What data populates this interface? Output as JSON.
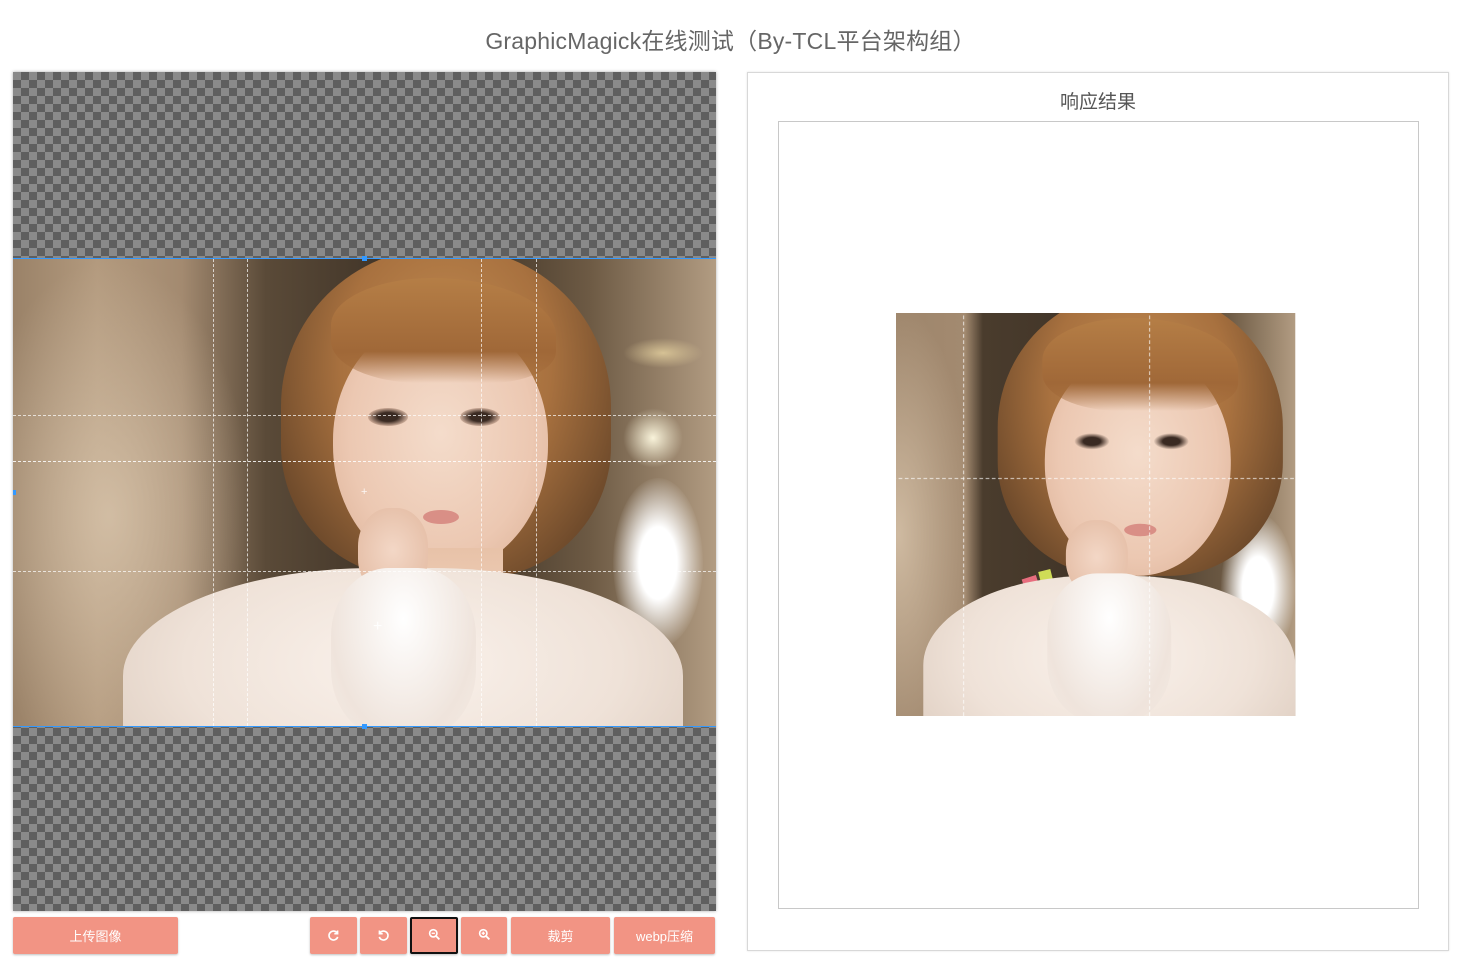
{
  "page": {
    "title": "GraphicMagick在线测试（By-TCL平台架构组）"
  },
  "editor": {
    "image_alt": "待裁剪图片（女孩肖像）"
  },
  "toolbar": {
    "upload_label": "上传图像",
    "rotate_right_icon": "rotate-right-icon",
    "rotate_left_icon": "rotate-left-icon",
    "zoom_out_icon": "zoom-out-icon",
    "zoom_in_icon": "zoom-in-icon",
    "crop_label": "裁剪",
    "webp_label": "webp压缩",
    "active_button": "zoom-out"
  },
  "result": {
    "title": "响应结果"
  },
  "colors": {
    "button": "#f29484",
    "crop_border": "#3399ff",
    "checker_dark": "#5f5f5f",
    "checker_light": "#8a8a8a"
  }
}
